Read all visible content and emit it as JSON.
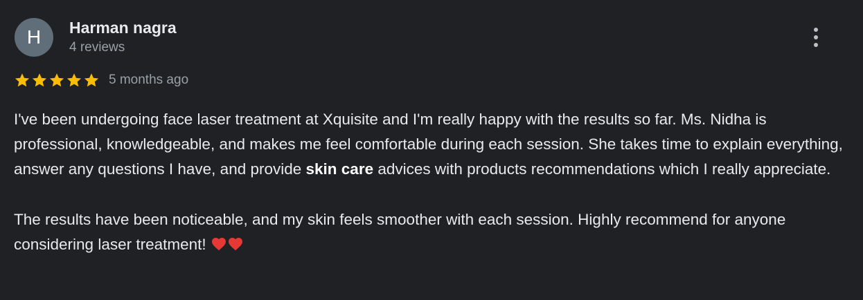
{
  "review": {
    "avatar_letter": "H",
    "author_name": "Harman nagra",
    "review_count": "4 reviews",
    "rating": 5,
    "rating_max": 5,
    "time_ago": "5 months ago",
    "paragraph1_part1": "I've been undergoing face laser treatment at Xquisite and I'm really happy with the results so far. Ms. Nidha is professional, knowledgeable, and makes me feel comfortable during each session. She takes time to explain everything, answer any questions I have, and provide ",
    "paragraph1_bold": "skin care",
    "paragraph1_part2": " advices with products recommendations which I really appreciate.",
    "paragraph2_text": "The results have been noticeable, and my skin feels smoother with each session. Highly recommend for anyone considering laser treatment! ",
    "paragraph2_emoji": "❤️❤️"
  },
  "icons": {
    "star": "star-icon",
    "more": "more-vert-icon",
    "heart": "red-heart-emoji"
  },
  "colors": {
    "background": "#202124",
    "avatar_bg": "#5f6e79",
    "star": "#fbbc04",
    "primary_text": "#e8eaed",
    "secondary_text": "#9aa0a6",
    "heart": "#e53935"
  }
}
